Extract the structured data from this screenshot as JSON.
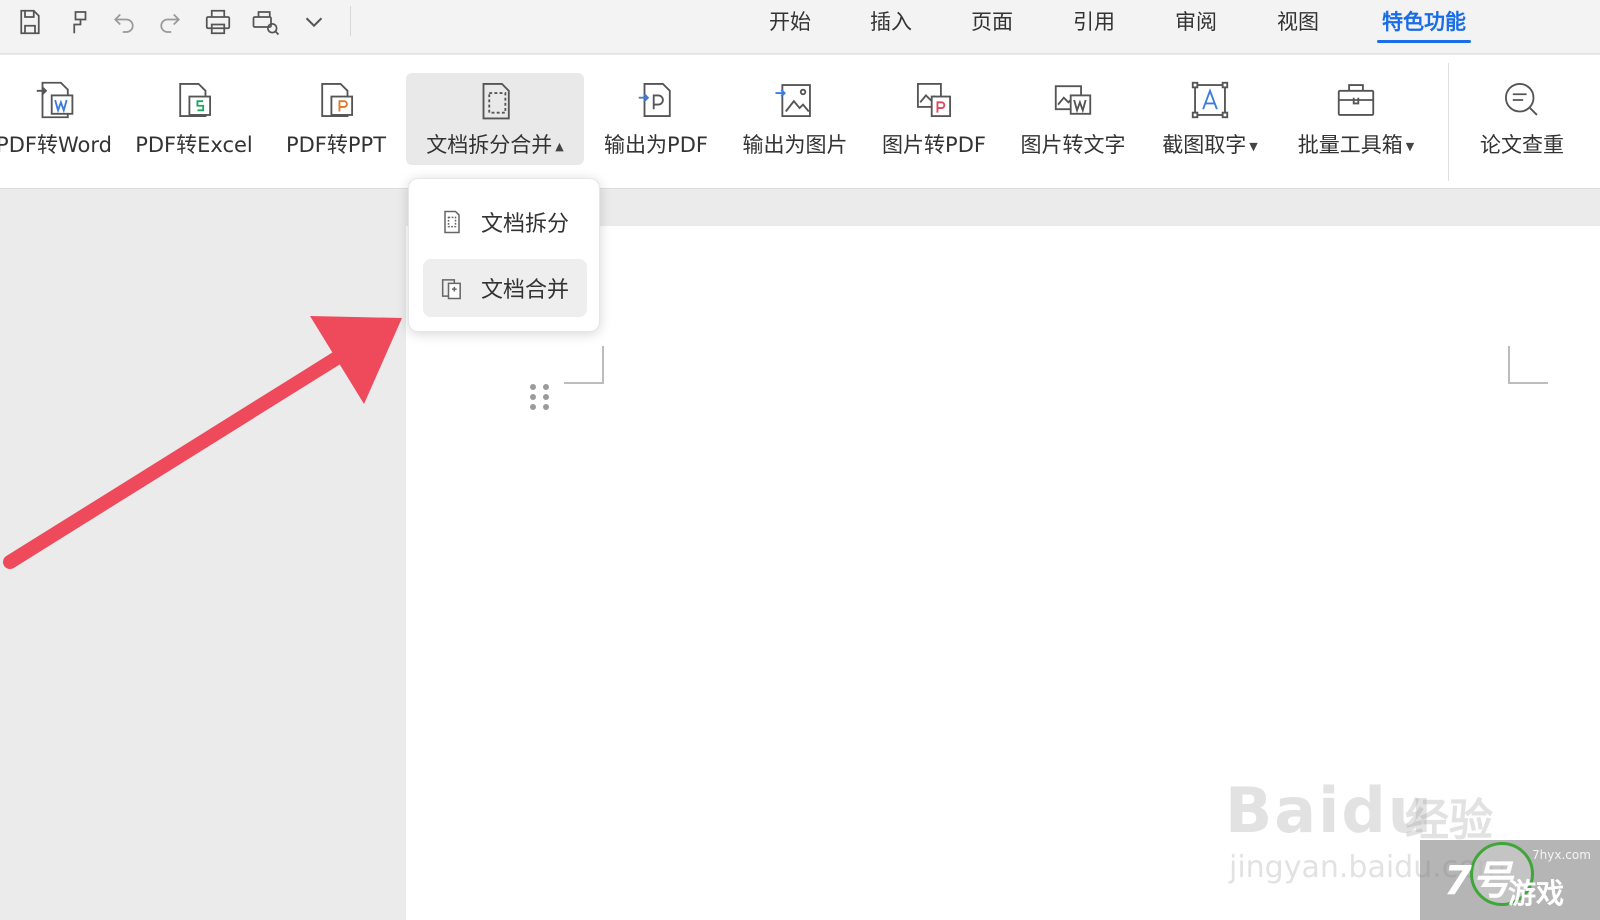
{
  "quick_access": {
    "icons": [
      "save-icon",
      "format-painter-icon",
      "undo-icon",
      "redo-icon",
      "print-icon",
      "print-preview-icon",
      "more-chevron-icon"
    ]
  },
  "menu": {
    "tabs": [
      {
        "label": "开始",
        "active": false
      },
      {
        "label": "插入",
        "active": false
      },
      {
        "label": "页面",
        "active": false
      },
      {
        "label": "引用",
        "active": false
      },
      {
        "label": "审阅",
        "active": false
      },
      {
        "label": "视图",
        "active": false
      },
      {
        "label": "特色功能",
        "active": true
      }
    ],
    "active_color": "#1a6de8"
  },
  "ribbon": {
    "buttons": [
      {
        "label": "PDF转Word",
        "icon": "pdf-to-word-icon"
      },
      {
        "label": "PDF转Excel",
        "icon": "pdf-to-excel-icon"
      },
      {
        "label": "PDF转PPT",
        "icon": "pdf-to-ppt-icon"
      },
      {
        "label": "文档拆分合并",
        "icon": "split-merge-icon",
        "expanded": true
      },
      {
        "label": "输出为PDF",
        "icon": "export-pdf-icon"
      },
      {
        "label": "输出为图片",
        "icon": "export-image-icon"
      },
      {
        "label": "图片转PDF",
        "icon": "image-to-pdf-icon"
      },
      {
        "label": "图片转文字",
        "icon": "image-to-text-icon"
      },
      {
        "label": "截图取字",
        "icon": "screenshot-ocr-icon",
        "has_dropdown": true
      },
      {
        "label": "批量工具箱",
        "icon": "batch-toolbox-icon",
        "has_dropdown": true
      },
      {
        "label": "论文查重",
        "icon": "paper-check-icon"
      }
    ]
  },
  "dropdown": {
    "items": [
      {
        "label": "文档拆分",
        "icon": "split-doc-icon",
        "hovered": false
      },
      {
        "label": "文档合并",
        "icon": "merge-doc-icon",
        "hovered": true
      }
    ]
  },
  "annotation": {
    "arrow_color": "#ee4a5c"
  },
  "watermarks": {
    "baidu_main": "Baidu",
    "baidu_cn": "经验",
    "baidu_sub": "jingyan.baidu.com",
    "site_num": "7号",
    "site_text": "游戏",
    "site_url": "7hyx.com"
  }
}
